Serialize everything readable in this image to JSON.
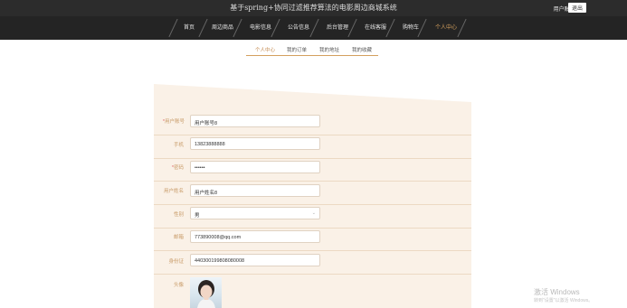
{
  "header": {
    "site_title": "基于spring+协同过滤推荐算法的电影周边商城系统",
    "user_label": "用户账号8",
    "logout_label": "退出"
  },
  "nav": {
    "items": [
      "首页",
      "周边商品",
      "电影信息",
      "公告信息",
      "后台管理",
      "在线客服",
      "购物车",
      "个人中心"
    ],
    "active_index": 7
  },
  "subtabs": {
    "items": [
      "个人中心",
      "我的订单",
      "我的地址",
      "我的收藏"
    ],
    "active_index": 0
  },
  "form": {
    "account_label": "用户账号",
    "account_value": "用户账号8",
    "phone_label": "手机",
    "phone_value": "13823888888",
    "password_label": "密码",
    "password_value": "••••••",
    "name_label": "用户姓名",
    "name_value": "用户姓名8",
    "gender_label": "性别",
    "gender_value": "男",
    "email_label": "邮箱",
    "email_value": "773890008@qq.com",
    "idcard_label": "身份证",
    "idcard_value": "440300199808080008",
    "avatar_label": "头像",
    "required_mark": "*"
  },
  "watermark": {
    "title": "激活 Windows",
    "subtitle": "转到\"设置\"以激活 Windows。"
  },
  "colors": {
    "accent": "#d4a05e",
    "panel_bg": "#faf1e7",
    "nav_bg": "#242424"
  }
}
